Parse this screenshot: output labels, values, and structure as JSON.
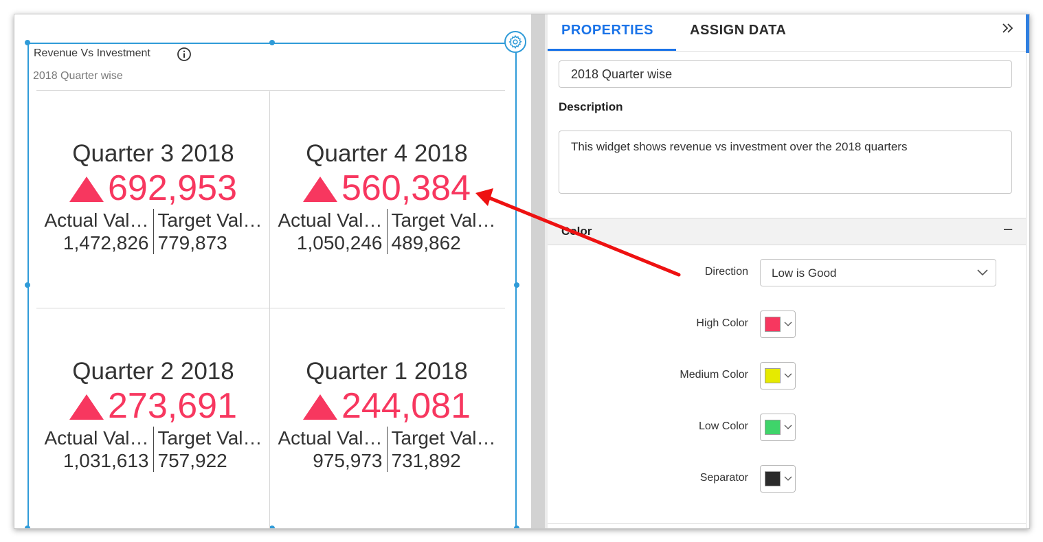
{
  "widget": {
    "title": "Revenue Vs Investment",
    "subtitle": "2018 Quarter wise",
    "indicator_color": "#f7375f",
    "cards": [
      {
        "quarter": "Quarter 3 2018",
        "value": "692,953",
        "actual_label": "Actual Val…",
        "actual_value": "1,472,826",
        "target_label": "Target Val…",
        "target_value": "779,873"
      },
      {
        "quarter": "Quarter 4 2018",
        "value": "560,384",
        "actual_label": "Actual Val…",
        "actual_value": "1,050,246",
        "target_label": "Target Val…",
        "target_value": "489,862"
      },
      {
        "quarter": "Quarter 2 2018",
        "value": "273,691",
        "actual_label": "Actual Val…",
        "actual_value": "1,031,613",
        "target_label": "Target Val…",
        "target_value": "757,922"
      },
      {
        "quarter": "Quarter 1 2018",
        "value": "244,081",
        "actual_label": "Actual Val…",
        "actual_value": "975,973",
        "target_label": "Target Val…",
        "target_value": "731,892"
      }
    ]
  },
  "panel": {
    "tabs": {
      "properties": "PROPERTIES",
      "assign_data": "ASSIGN DATA"
    },
    "name_value": "2018 Quarter wise",
    "description_label": "Description",
    "description_value": "This widget shows revenue vs investment over the 2018 quarters",
    "color_section": {
      "title": "Color",
      "direction_label": "Direction",
      "direction_value": "Low is Good",
      "high_label": "High Color",
      "high_color": "#f7375f",
      "medium_label": "Medium Color",
      "medium_color": "#e6ea00",
      "low_label": "Low Color",
      "low_color": "#3fd46a",
      "separator_label": "Separator",
      "separator_color": "#2b2b2b"
    }
  },
  "accent_color": "#1a73e8",
  "selection_color": "#2f9bd8",
  "annotation_arrow_color": "#ee1111"
}
